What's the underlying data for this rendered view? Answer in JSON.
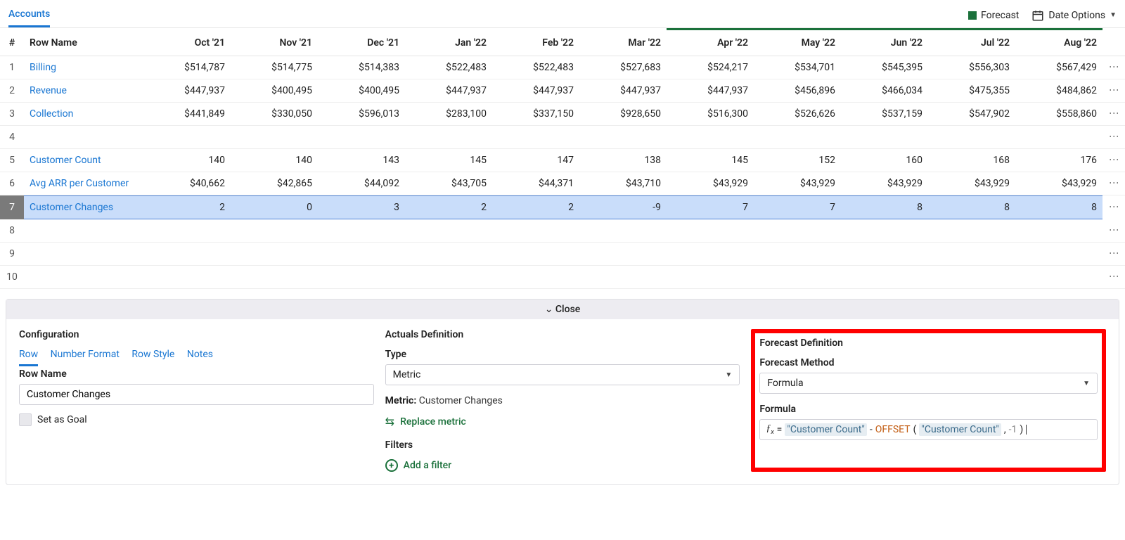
{
  "topbar": {
    "tab": "Accounts",
    "forecast_label": "Forecast",
    "date_options": "Date Options"
  },
  "columns": [
    "Oct '21",
    "Nov '21",
    "Dec '21",
    "Jan '22",
    "Feb '22",
    "Mar '22",
    "Apr '22",
    "May '22",
    "Jun '22",
    "Jul '22",
    "Aug '22"
  ],
  "col_head_num": "#",
  "col_head_name": "Row Name",
  "rows": [
    {
      "idx": "1",
      "name": "Billing",
      "link": true,
      "vals": [
        "$514,787",
        "$514,775",
        "$514,383",
        "$522,483",
        "$522,483",
        "$527,683",
        "$524,217",
        "$534,701",
        "$545,395",
        "$556,303",
        "$567,429"
      ]
    },
    {
      "idx": "2",
      "name": "Revenue",
      "link": true,
      "vals": [
        "$447,937",
        "$400,495",
        "$400,495",
        "$447,937",
        "$447,937",
        "$447,937",
        "$447,937",
        "$456,896",
        "$466,034",
        "$475,355",
        "$484,862"
      ]
    },
    {
      "idx": "3",
      "name": "Collection",
      "link": true,
      "vals": [
        "$441,849",
        "$330,050",
        "$596,013",
        "$283,100",
        "$337,150",
        "$928,650",
        "$516,300",
        "$526,626",
        "$537,159",
        "$547,902",
        "$558,860"
      ]
    },
    {
      "idx": "4",
      "name": "",
      "link": false,
      "vals": [
        "",
        "",
        "",
        "",
        "",
        "",
        "",
        "",
        "",
        "",
        ""
      ]
    },
    {
      "idx": "5",
      "name": "Customer Count",
      "link": true,
      "vals": [
        "140",
        "140",
        "143",
        "145",
        "147",
        "138",
        "145",
        "152",
        "160",
        "168",
        "176"
      ]
    },
    {
      "idx": "6",
      "name": "Avg ARR per Customer",
      "link": true,
      "vals": [
        "$40,662",
        "$42,865",
        "$44,092",
        "$43,705",
        "$44,371",
        "$43,710",
        "$43,929",
        "$43,929",
        "$43,929",
        "$43,929",
        "$43,929"
      ]
    },
    {
      "idx": "7",
      "name": "Customer Changes",
      "link": true,
      "selected": true,
      "vals": [
        "2",
        "0",
        "3",
        "2",
        "2",
        "-9",
        "7",
        "7",
        "8",
        "8",
        "8"
      ]
    },
    {
      "idx": "8",
      "name": "",
      "link": false,
      "vals": [
        "",
        "",
        "",
        "",
        "",
        "",
        "",
        "",
        "",
        "",
        ""
      ]
    },
    {
      "idx": "9",
      "name": "",
      "link": false,
      "vals": [
        "",
        "",
        "",
        "",
        "",
        "",
        "",
        "",
        "",
        "",
        ""
      ]
    },
    {
      "idx": "10",
      "name": "",
      "link": false,
      "vals": [
        "",
        "",
        "",
        "",
        "",
        "",
        "",
        "",
        "",
        "",
        ""
      ]
    }
  ],
  "panel": {
    "close": "Close",
    "config": {
      "title": "Configuration",
      "tabs": [
        "Row",
        "Number Format",
        "Row Style",
        "Notes"
      ],
      "row_name_label": "Row Name",
      "row_name_value": "Customer Changes",
      "set_goal": "Set as Goal"
    },
    "actuals": {
      "title": "Actuals Definition",
      "type_label": "Type",
      "type_value": "Metric",
      "metric_label": "Metric:",
      "metric_value": "Customer Changes",
      "replace": "Replace metric",
      "filters": "Filters",
      "add_filter": "Add a filter"
    },
    "forecast": {
      "title": "Forecast Definition",
      "method_label": "Forecast Method",
      "method_value": "Formula",
      "formula_label": "Formula",
      "formula": {
        "eq": "= ",
        "f1": "\"Customer Count\"",
        "minus": "-",
        "func": "OFFSET",
        "open": "(",
        "f2": "\"Customer Count\"",
        "comma": ",",
        "num": "-1",
        "close": ")"
      }
    }
  }
}
